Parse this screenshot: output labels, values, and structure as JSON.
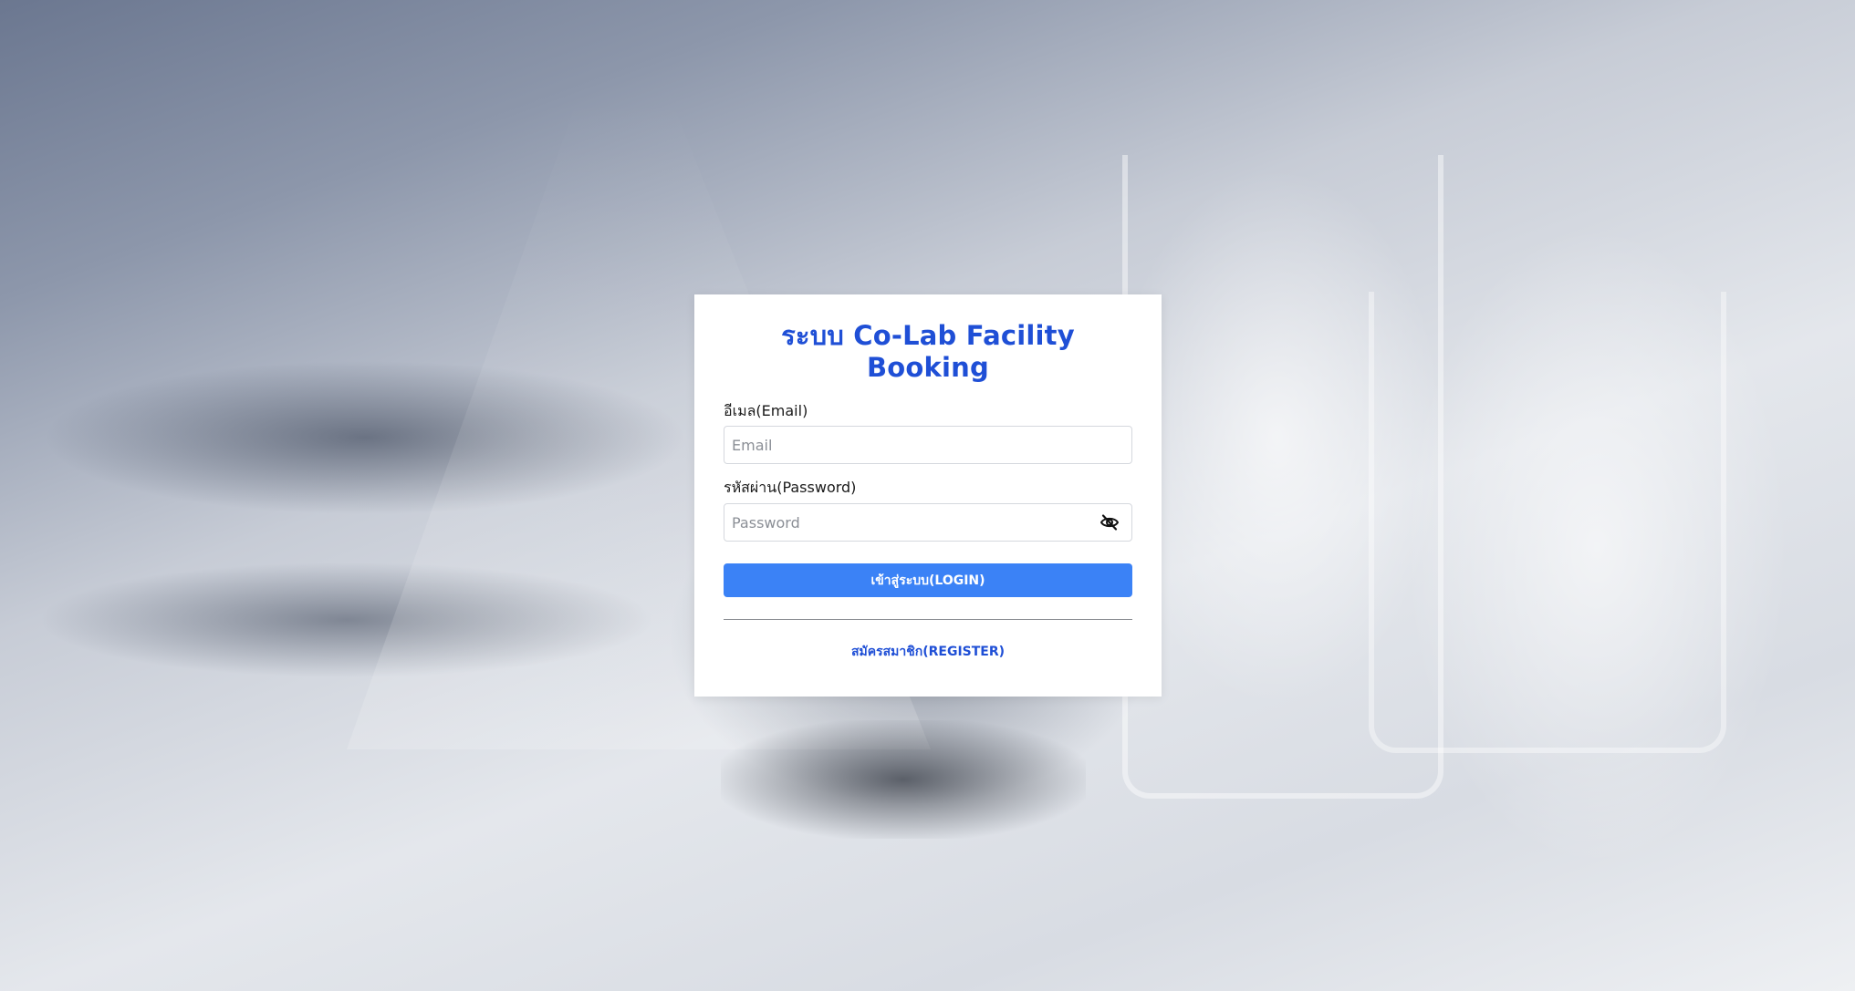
{
  "login_form": {
    "title": "ระบบ Co-Lab Facility Booking",
    "email": {
      "label": "อีเมล(Email)",
      "placeholder": "Email",
      "value": ""
    },
    "password": {
      "label": "รหัสผ่าน(Password)",
      "placeholder": "Password",
      "value": "",
      "toggle_icon": "eye-slash-icon"
    },
    "login_button_label": "เข้าสู่ระบบ(LOGIN)",
    "register_link_label": "สมัครสมาชิก(REGISTER)"
  },
  "colors": {
    "title": "#1f4fd6",
    "button_background": "#3b82f6",
    "link": "#1f4fd6"
  }
}
